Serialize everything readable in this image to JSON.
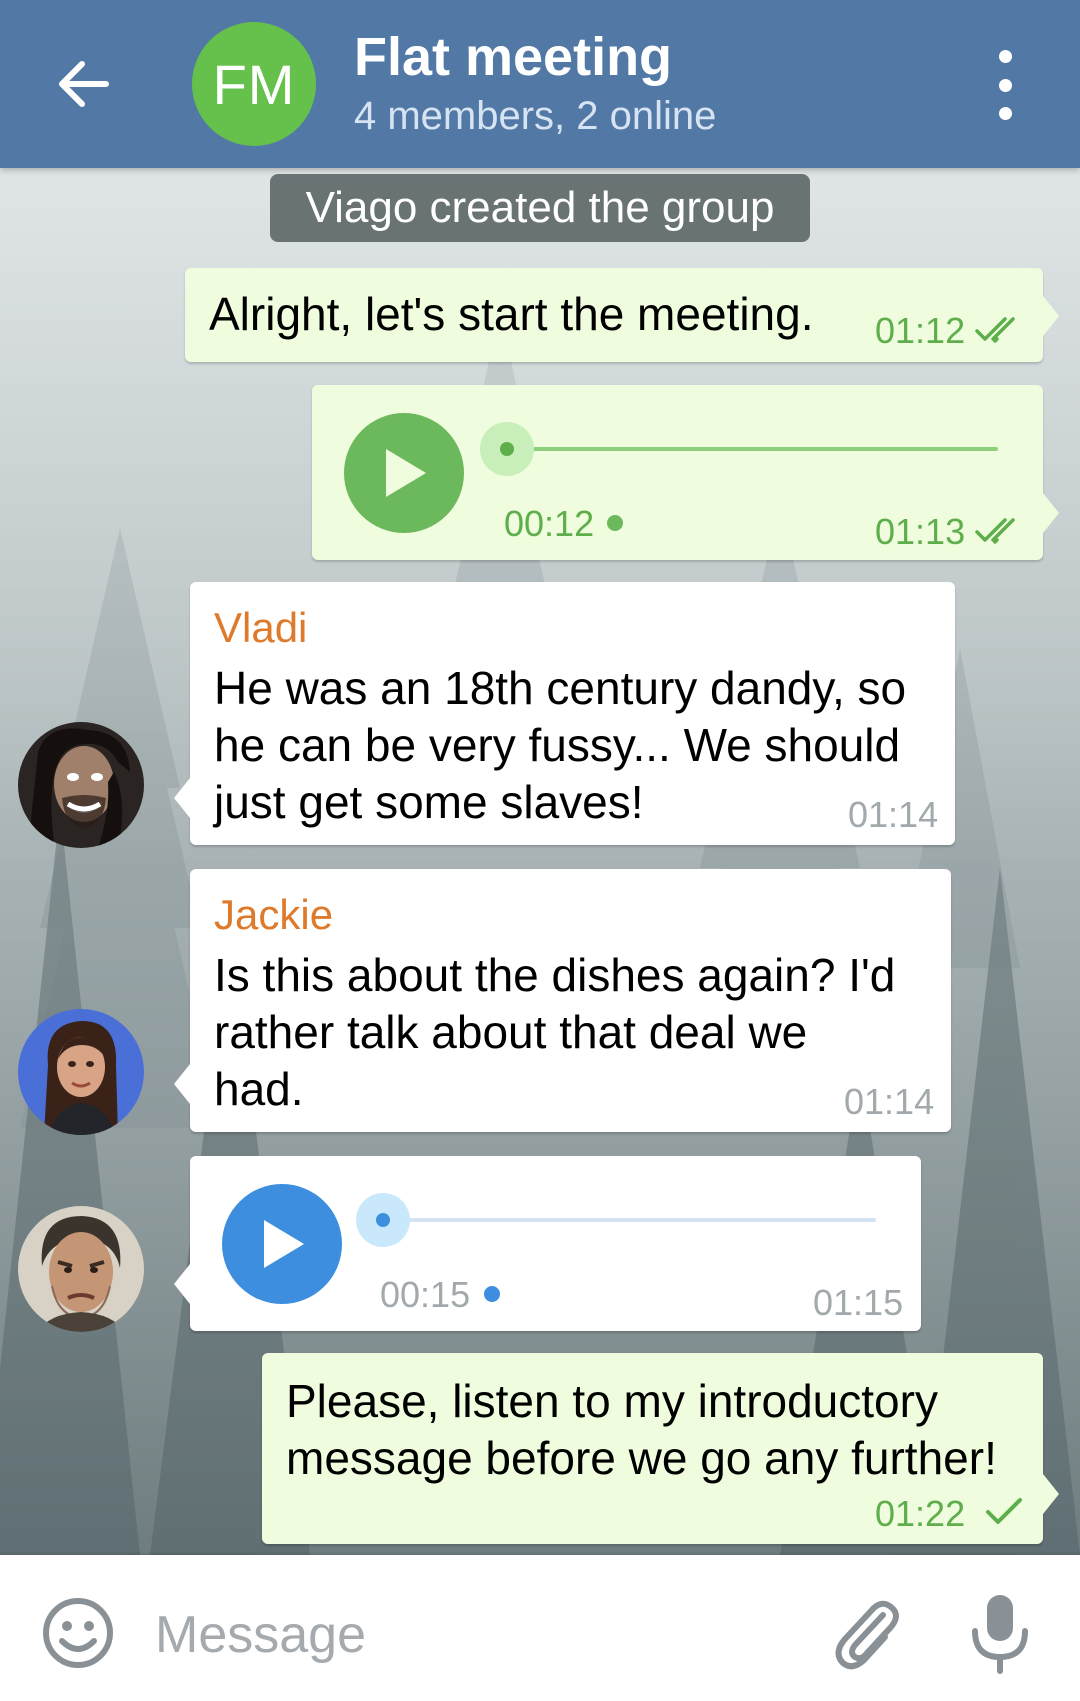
{
  "header": {
    "avatar_initials": "FM",
    "avatar_color": "#65c14c",
    "title": "Flat meeting",
    "subtitle": "4 members, 2 online",
    "back_icon": "arrow-left-icon",
    "menu_icon": "more-vertical-icon",
    "bar_color": "#5278a6"
  },
  "service_message": "Viago created the group",
  "messages": [
    {
      "type": "text",
      "direction": "out",
      "text": "Alright, let's start the meeting.",
      "time": "01:12",
      "status": "read"
    },
    {
      "type": "voice",
      "direction": "out",
      "duration": "00:12",
      "time": "01:13",
      "status": "read",
      "progress": 0
    },
    {
      "type": "text",
      "direction": "in",
      "sender": "Vladi",
      "lines": [
        "He was an 18th century dandy, so",
        "he can be very fussy... We should",
        "just get some slaves!"
      ],
      "time": "01:14"
    },
    {
      "type": "text",
      "direction": "in",
      "sender": "Jackie",
      "lines": [
        "Is this about the dishes again? I'd",
        "rather talk about that deal we",
        "had."
      ],
      "time": "01:14"
    },
    {
      "type": "voice",
      "direction": "in",
      "duration": "00:15",
      "time": "01:15",
      "progress": 0
    },
    {
      "type": "text",
      "direction": "out",
      "lines": [
        "Please, listen to my introductory",
        "message before we go any further!"
      ],
      "time": "01:22",
      "status": "sent"
    }
  ],
  "input": {
    "placeholder": "Message",
    "value": "",
    "emoji_icon": "smile-icon",
    "attach_icon": "paperclip-icon",
    "mic_icon": "microphone-icon"
  },
  "colors": {
    "outgoing_bubble": "#effdde",
    "incoming_bubble": "#ffffff",
    "sender_name": "#de7a2b",
    "outgoing_accent": "#6cb85c",
    "incoming_accent": "#3e8ee0"
  }
}
